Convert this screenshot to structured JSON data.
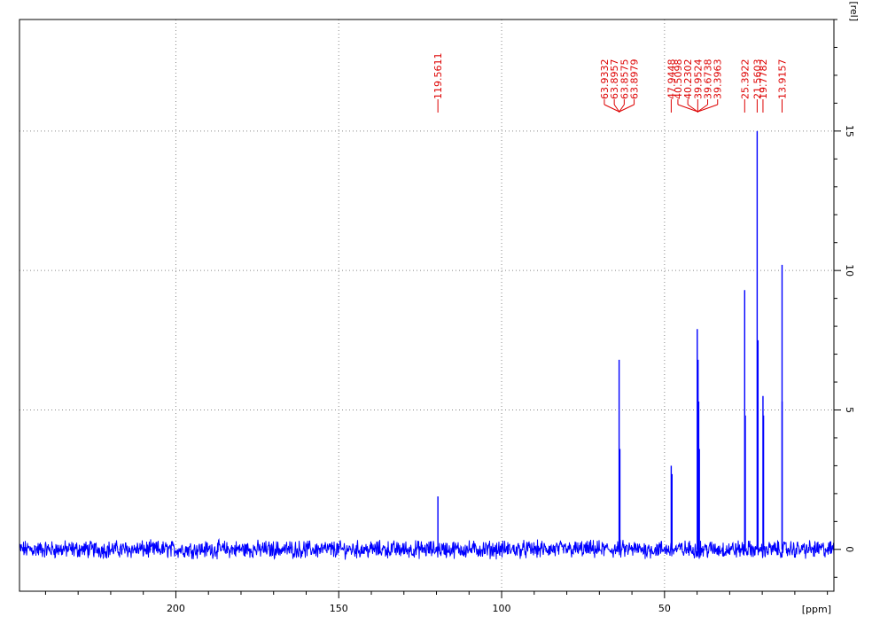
{
  "chart_data": {
    "type": "line",
    "x_unit_label": "[ppm]",
    "y_unit_label": "[rel]",
    "xlim": [
      248,
      -2
    ],
    "ylim": [
      -1.5,
      19
    ],
    "x_ticks": [
      200,
      150,
      100,
      50
    ],
    "y_ticks": [
      0,
      5,
      10,
      15
    ],
    "x_minor_step": 10,
    "y_minor_step": 1,
    "grid": true,
    "colors": {
      "spectrum": "#0000ff",
      "labels": "#dd0000",
      "frame": "#000000",
      "grid": "#888888"
    },
    "noise_amplitude": 0.25,
    "peaks": [
      {
        "x": 119.5611,
        "y": 1.9
      },
      {
        "x": 63.9332,
        "y": 6.8
      },
      {
        "x": 63.7,
        "y": 3.6
      },
      {
        "x": 47.9448,
        "y": 3.0
      },
      {
        "x": 47.7,
        "y": 2.7
      },
      {
        "x": 39.9524,
        "y": 7.9
      },
      {
        "x": 39.7,
        "y": 6.8
      },
      {
        "x": 39.5,
        "y": 5.3
      },
      {
        "x": 39.3,
        "y": 3.6
      },
      {
        "x": 25.3922,
        "y": 9.3
      },
      {
        "x": 25.2,
        "y": 4.8
      },
      {
        "x": 21.5603,
        "y": 15.0
      },
      {
        "x": 21.3,
        "y": 7.5
      },
      {
        "x": 19.7782,
        "y": 5.5
      },
      {
        "x": 19.6,
        "y": 4.8
      },
      {
        "x": 13.9157,
        "y": 10.2
      },
      {
        "x": 13.9,
        "y": 5.3
      }
    ],
    "annotation_groups": [
      {
        "anchor": 119.5611,
        "labels": [
          "119.5611"
        ]
      },
      {
        "anchor": 63.9,
        "labels": [
          "63.9332",
          "63.8957",
          "63.8575",
          "63.8979"
        ]
      },
      {
        "anchor": 47.9448,
        "labels": [
          "47.9448"
        ]
      },
      {
        "anchor": 39.8,
        "labels": [
          "40.5098",
          "40.2302",
          "39.9524",
          "39.6738",
          "39.3963"
        ]
      },
      {
        "anchor": 25.3922,
        "labels": [
          "25.3922"
        ]
      },
      {
        "anchor": 21.5603,
        "labels": [
          "21.5603"
        ]
      },
      {
        "anchor": 19.7782,
        "labels": [
          "19.7782"
        ]
      },
      {
        "anchor": 13.9157,
        "labels": [
          "13.9157"
        ]
      }
    ]
  }
}
